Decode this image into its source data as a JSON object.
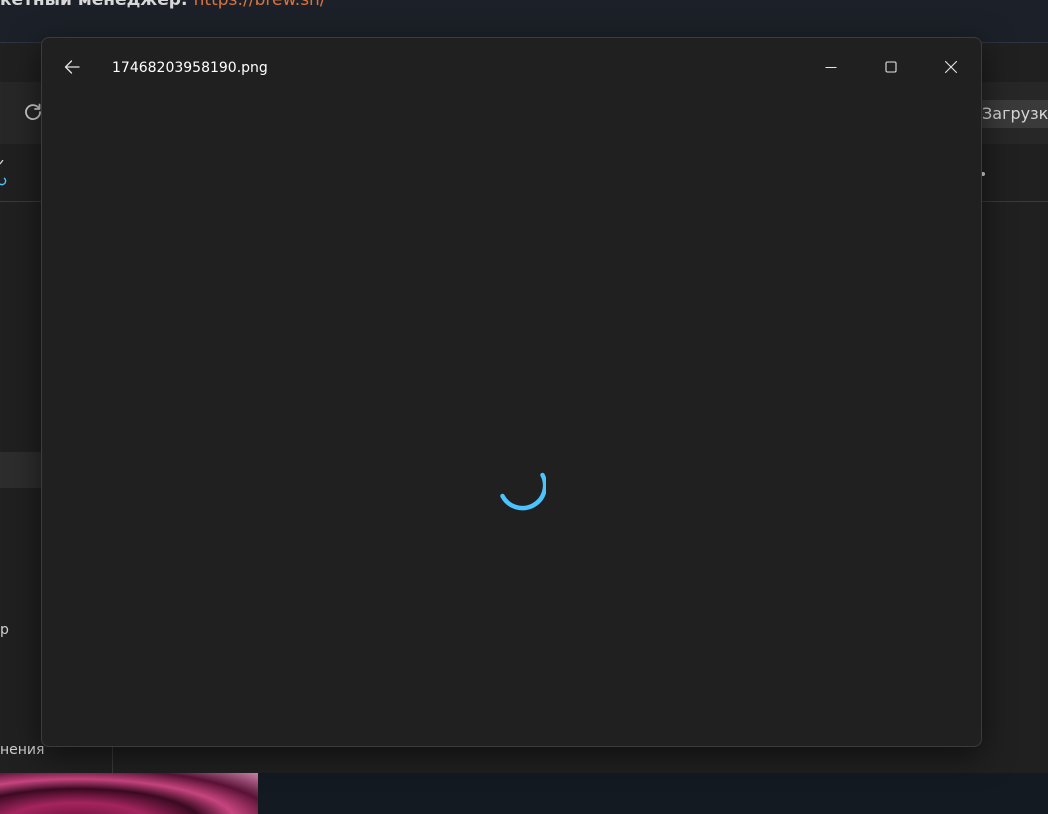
{
  "background_window": {
    "heading_text": "кетный менеджер: ",
    "heading_link": "https://brew.sh/",
    "downloads_label": "Загрузки",
    "side_items": [
      "р",
      "нения"
    ]
  },
  "viewer": {
    "title": "17468203958190.png",
    "icons": {
      "back": "arrow-left-icon",
      "minimize": "minimize-icon",
      "maximize": "maximize-icon",
      "close": "close-icon",
      "loading": "loading-spinner-icon"
    },
    "accent_color": "#4cc2ff"
  }
}
